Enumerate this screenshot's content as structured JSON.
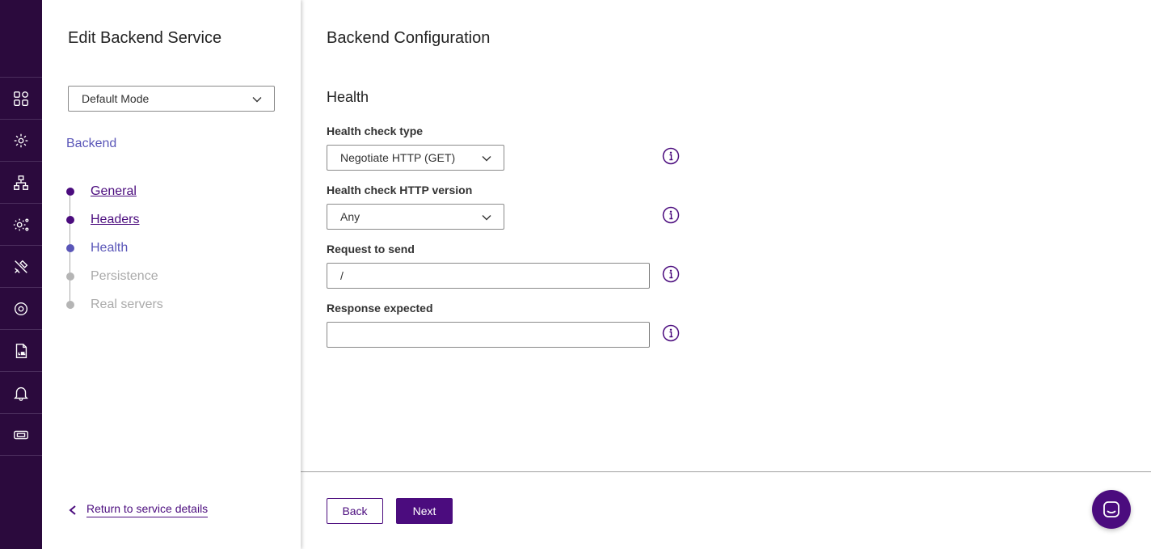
{
  "rail": {
    "items": [
      {
        "icon": "dashboard-grid-icon"
      },
      {
        "icon": "services-gear-icon"
      },
      {
        "icon": "network-topology-icon"
      },
      {
        "icon": "system-settings-icon"
      },
      {
        "icon": "tools-icon"
      },
      {
        "icon": "settings-gear-icon"
      },
      {
        "icon": "log-file-icon"
      },
      {
        "icon": "notification-bell-icon"
      },
      {
        "icon": "ticket-icon"
      }
    ]
  },
  "panel": {
    "title": "Edit Backend Service",
    "mode_select": {
      "value": "Default Mode"
    },
    "section_label": "Backend",
    "steps": [
      {
        "label": "General",
        "state": "done"
      },
      {
        "label": "Headers",
        "state": "done"
      },
      {
        "label": "Health",
        "state": "current"
      },
      {
        "label": "Persistence",
        "state": "todo"
      },
      {
        "label": "Real servers",
        "state": "todo"
      }
    ],
    "return_link": "Return to service details"
  },
  "main": {
    "title": "Backend Configuration",
    "section_title": "Health",
    "fields": {
      "health_check_type": {
        "label": "Health check type",
        "value": "Negotiate HTTP (GET)"
      },
      "health_check_http_version": {
        "label": "Health check HTTP version",
        "value": "Any"
      },
      "request_to_send": {
        "label": "Request to send",
        "value": "/"
      },
      "response_expected": {
        "label": "Response expected",
        "value": ""
      }
    },
    "buttons": {
      "back": "Back",
      "next": "Next"
    }
  },
  "colors": {
    "rail_bg": "#2b0a3d",
    "primary": "#4b0c7e",
    "link": "#5a56b8",
    "inactive": "#aaaaaa"
  }
}
